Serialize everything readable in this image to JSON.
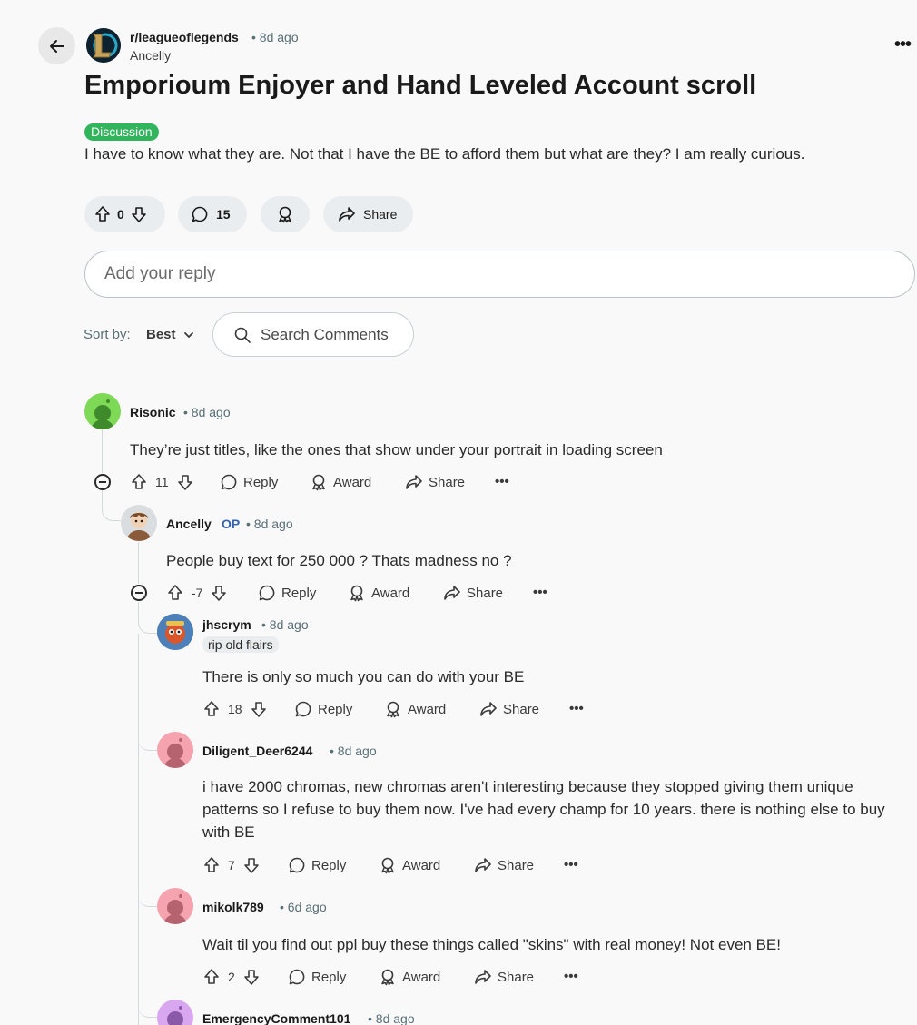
{
  "header": {
    "subreddit": "r/leagueoflegends",
    "time": "• 8d ago",
    "author": "Ancelly",
    "more": "•••"
  },
  "post": {
    "title": "Emporioum Enjoyer and Hand Leveled Account scroll",
    "flair": "Discussion",
    "body": "I have to know what they are. Not that I have the BE to afford them but what are they? I am really curious.",
    "votes": "0",
    "comments": "15",
    "share": "Share"
  },
  "reply_box": {
    "placeholder": "Add your reply"
  },
  "sort": {
    "label": "Sort by:",
    "value": "Best"
  },
  "search": {
    "placeholder": "Search Comments"
  },
  "comments": [
    {
      "author": "Risonic",
      "time": "• 8d ago",
      "text": "They’re just titles, like the ones that show under your portrait in loading screen",
      "votes": "11"
    },
    {
      "author": "Ancelly",
      "op": "OP",
      "time": "• 8d ago",
      "text": "People buy text for 250 000 ? Thats madness no ?",
      "votes": "-7"
    },
    {
      "author": "jhscrym",
      "time": "• 8d ago",
      "flair": "rip old flairs",
      "text": "There is only so much you can do with your BE",
      "votes": "18"
    },
    {
      "author": "Diligent_Deer6244",
      "time": "• 8d ago",
      "text_lines": [
        "i have 2000 chromas, new chromas aren't interesting because they stopped giving them unique",
        "patterns so I refuse to buy them now. I've had every champ for 10 years. there is nothing else to buy",
        "with BE"
      ],
      "votes": "7"
    },
    {
      "author": "mikolk789",
      "time": "• 6d ago",
      "text": "Wait til you find out ppl buy these things called \"skins\" with real money! Not even BE!",
      "votes": "2"
    },
    {
      "author": "EmergencyComment101",
      "time": "• 8d ago"
    }
  ],
  "actions": {
    "reply": "Reply",
    "award": "Award",
    "share": "Share",
    "more": "•••"
  },
  "colors": {
    "flair_bg": "#31b45c",
    "op_color": "#3565b1",
    "pill_bg": "#eaedef"
  }
}
